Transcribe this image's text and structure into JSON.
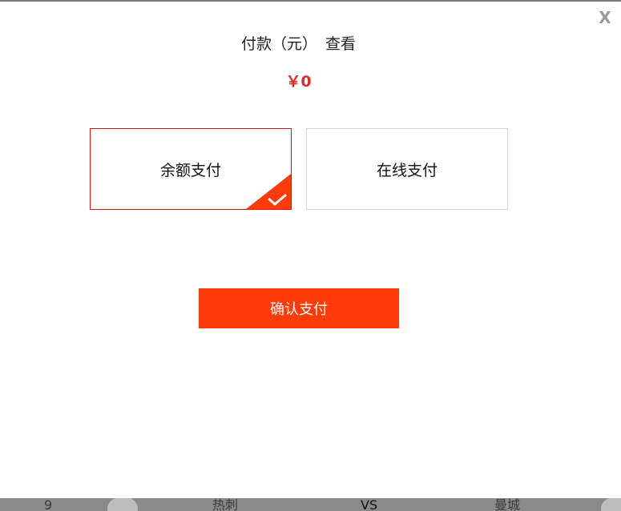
{
  "modal": {
    "close_label": "X",
    "title_part1": "付款（元）",
    "title_part2": "查看",
    "amount": "￥0",
    "options": [
      {
        "label": "余额支付",
        "selected": true
      },
      {
        "label": "在线支付",
        "selected": false
      }
    ],
    "confirm_label": "确认支付"
  },
  "background": {
    "row_texts": [
      "9",
      "热刺",
      "VS",
      "曼城"
    ]
  },
  "colors": {
    "accent": "#ff3b0a",
    "amount": "#e02b2b",
    "selected_border": "#cc1a1a"
  },
  "icons": {
    "checkmark": "checkmark-icon",
    "close": "close-icon"
  }
}
